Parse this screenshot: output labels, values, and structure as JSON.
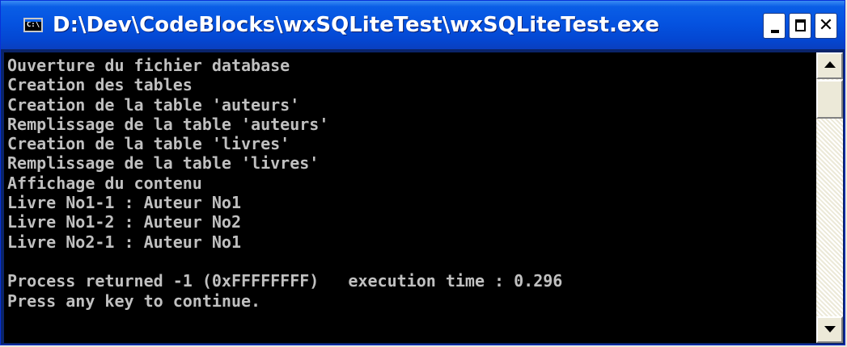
{
  "window": {
    "title": "D:\\Dev\\CodeBlocks\\wxSQLiteTest\\wxSQLiteTest.exe",
    "icon": "console-app-icon",
    "icon_label": "C:\\",
    "controls": {
      "minimize_icon": "minimize-icon",
      "maximize_icon": "maximize-icon",
      "close_icon": "close-icon",
      "close_glyph": "✕"
    }
  },
  "console": {
    "text_color": "#c0c0c0",
    "background": "#000000",
    "lines": [
      "Ouverture du fichier database",
      "Creation des tables",
      "Creation de la table 'auteurs'",
      "Remplissage de la table 'auteurs'",
      "Creation de la table 'livres'",
      "Remplissage de la table 'livres'",
      "Affichage du contenu",
      "Livre No1-1 : Auteur No1",
      "Livre No1-2 : Auteur No2",
      "Livre No2-1 : Auteur No1",
      "",
      "Process returned -1 (0xFFFFFFFF)   execution time : 0.296",
      "Press any key to continue."
    ]
  },
  "scrollbar": {
    "up_icon": "scroll-up-arrow-icon",
    "down_icon": "scroll-down-arrow-icon"
  },
  "colors": {
    "titlebar": "#0553e0",
    "title_text": "#ffffff",
    "frame": "#0a246a"
  }
}
